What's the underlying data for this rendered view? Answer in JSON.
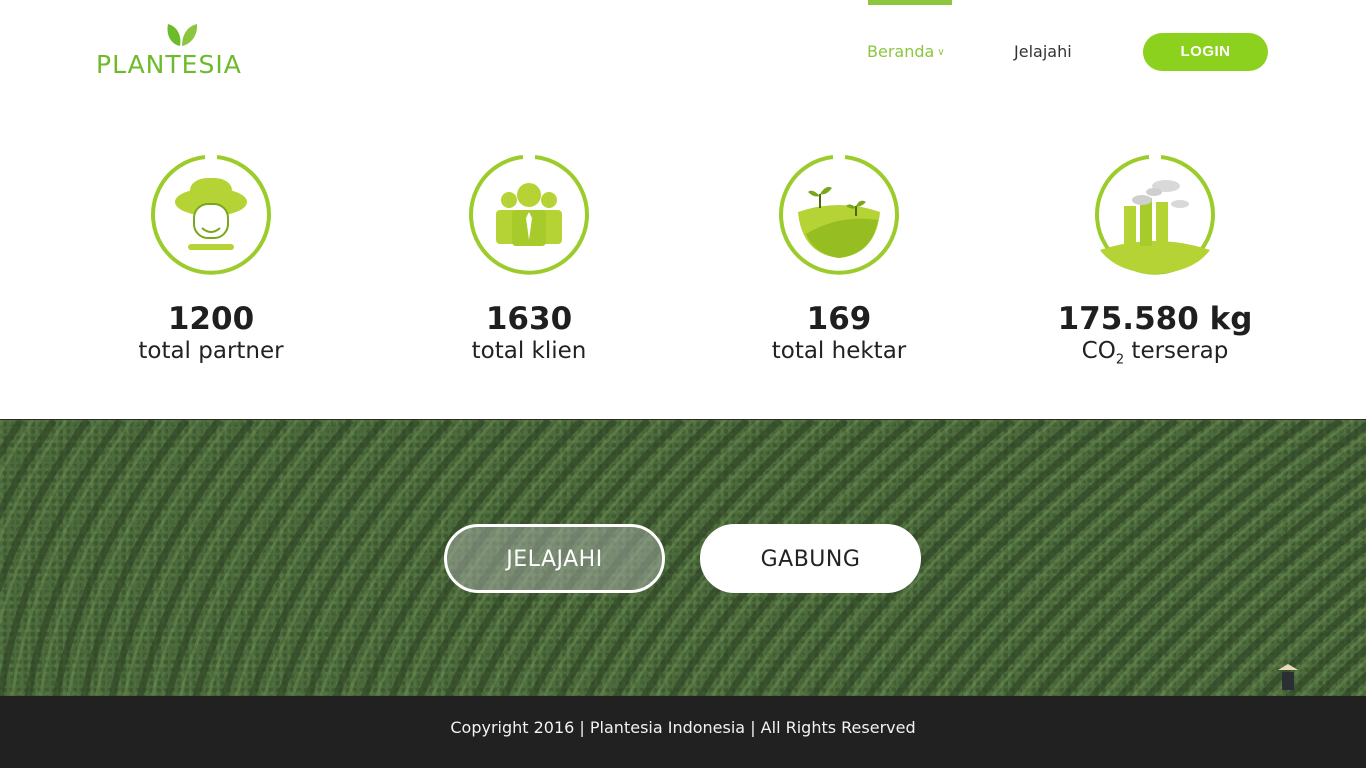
{
  "brand": {
    "name": "PLANTESIA",
    "color": "#6dbb2a"
  },
  "nav": {
    "items": [
      {
        "label": "Beranda",
        "active": true
      },
      {
        "label": "Jelajahi",
        "active": false
      }
    ],
    "login_label": "LOGIN",
    "accent": "#8cc63f"
  },
  "stats": [
    {
      "value": "1200",
      "label": "total partner",
      "icon": "farmer-icon"
    },
    {
      "value": "1630",
      "label": "total klien",
      "icon": "people-icon"
    },
    {
      "value": "169",
      "label": "total hektar",
      "icon": "land-sprout-icon"
    },
    {
      "value": "175.580 kg",
      "label_prefix": "CO",
      "label_sub": "2",
      "label_suffix": " terserap",
      "icon": "factory-icon"
    }
  ],
  "hero": {
    "buttons": [
      {
        "label": "JELAJAHI"
      },
      {
        "label": "GABUNG"
      }
    ]
  },
  "footer": {
    "text": "Copyright 2016 | Plantesia Indonesia | All Rights Reserved"
  }
}
